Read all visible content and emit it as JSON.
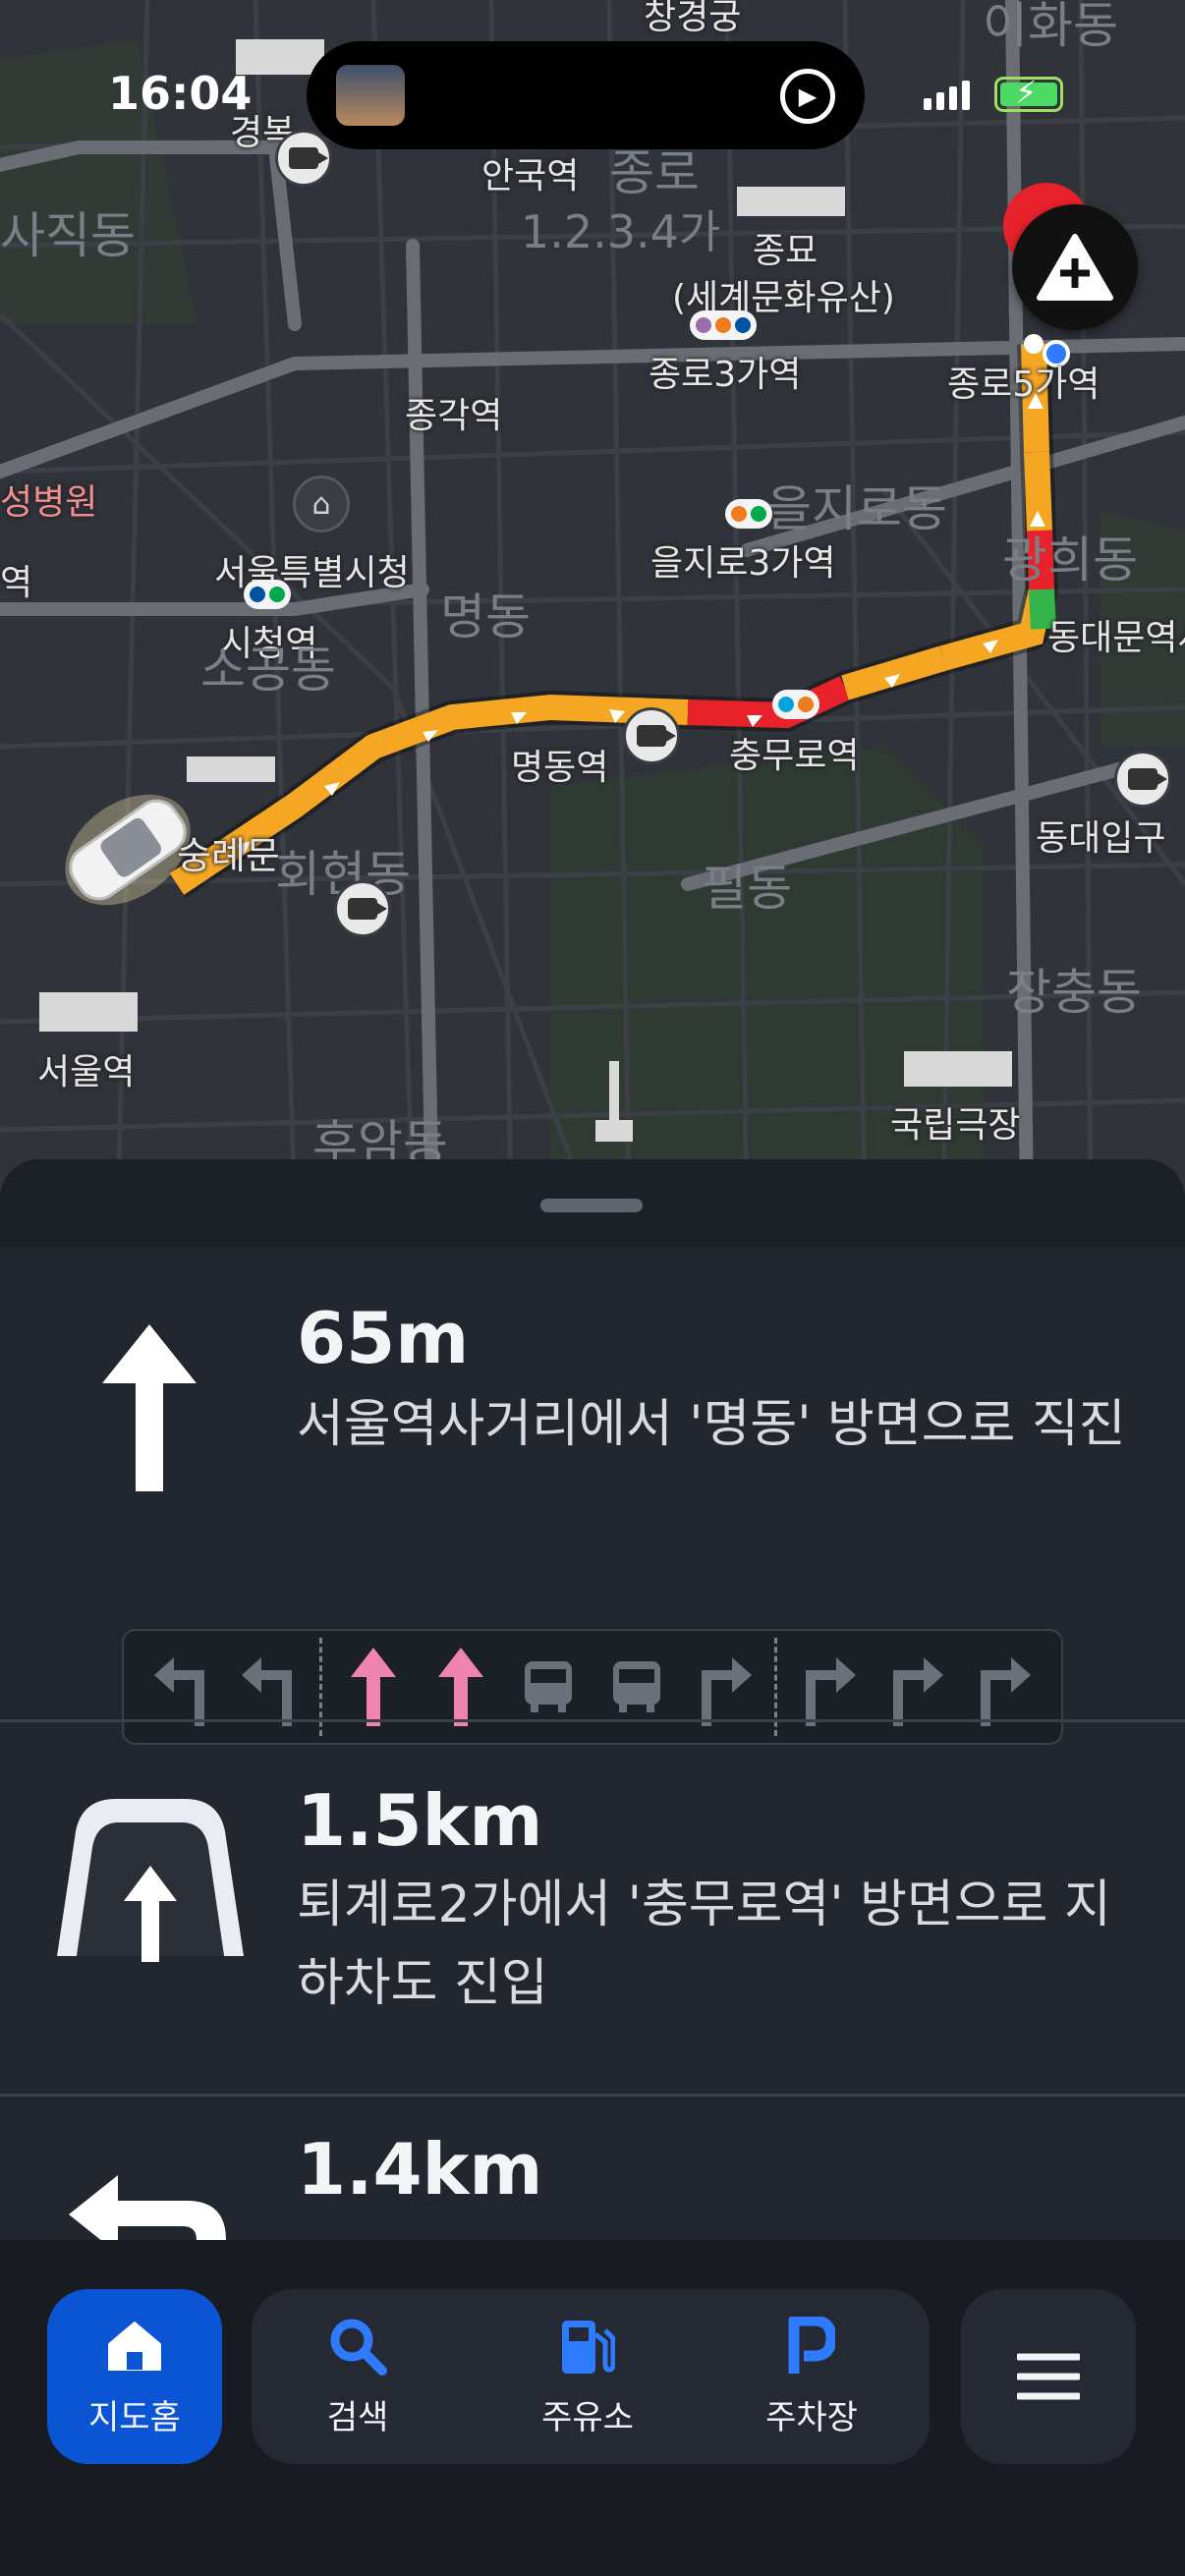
{
  "status_bar": {
    "time": "16:04"
  },
  "map": {
    "labels": {
      "changgyeonggung": "창경궁",
      "ihwadong": "이화동",
      "gyeongbok": "경복",
      "anguk": "안국역",
      "jongno_faint": "종로",
      "sajikdong": "사직동",
      "jongmyo": "종묘",
      "heritage": "(세계문화유산)",
      "jongno_1234": "1.2.3.4가",
      "jongno5": "종로5가역",
      "jongno3": "종로3가역",
      "jonggak": "종각역",
      "hospital": "성병원",
      "euljiro_dong": "을지로동",
      "euljiro3": "을지로3가역",
      "seoul_cityhall": "서울특별시청",
      "myeongdong_faint": "명동",
      "cityhall_stn": "시청역",
      "sogong": "소공동",
      "gwanghui": "광희동",
      "dongdaemun_stn": "동대문역사",
      "myeongdong_stn": "명동역",
      "chungmuro": "충무로역",
      "sungnyemun": "숭례문",
      "hoehyeon": "회현동",
      "pildong": "필동",
      "dongdaeipgu": "동대입구",
      "jangchung": "장충동",
      "seoul_stn": "서울역",
      "huam": "후암동",
      "national_theater": "국립극장",
      "left_edge": "역"
    }
  },
  "directions": [
    {
      "distance": "65m",
      "instruction": "서울역사거리에서 '명동' 방면으로 직진",
      "icon": "straight-arrow-icon"
    },
    {
      "distance": "1.5km",
      "instruction": "퇴계로2가에서 '충무로역' 방면으로 지하차도 진입",
      "icon": "underpass-icon"
    },
    {
      "distance": "1.4km",
      "instruction": "",
      "icon": "turn-left-icon"
    }
  ],
  "lanes": [
    "left",
    "left",
    "straight-active",
    "straight-active",
    "bus",
    "bus",
    "right",
    "right",
    "right",
    "right"
  ],
  "nav": {
    "home": "지도홈",
    "search": "검색",
    "gas": "주유소",
    "parking": "주차장"
  },
  "colors": {
    "route_orange": "#f5a623",
    "route_red": "#e8222b",
    "route_green": "#33b34a",
    "accent_blue": "#0b55d4",
    "lane_active": "#f084b0"
  }
}
